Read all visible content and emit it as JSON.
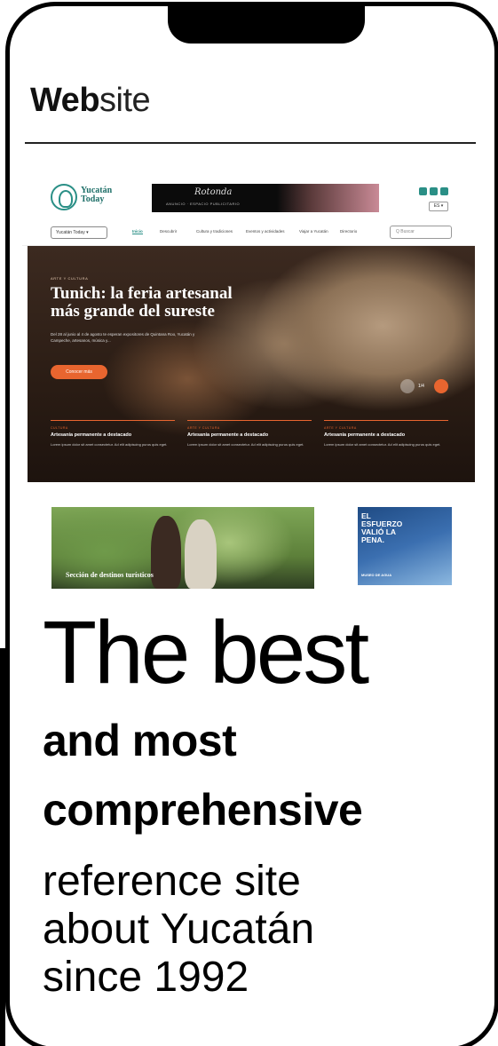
{
  "header": {
    "title_bold": "Web",
    "title_light": "site"
  },
  "site": {
    "logo_text_line1": "Yucatán",
    "logo_text_line2": "Today",
    "banner_script": "Rotonda",
    "banner_sub": "ANUNCIO · ESPACIO PUBLICITARIO",
    "lang": "ES ▾",
    "nav_select": "Yucatán Today ▾",
    "nav_items": [
      "Inicio",
      "Descubrir",
      "Cultura y tradiciones",
      "Eventos y actividades",
      "Viajar a Yucatán",
      "Directorio"
    ],
    "nav_search_placeholder": "Q  Buscar",
    "hero": {
      "tag": "ARTE Y CULTURA",
      "title": "Tunich: la feria artesanal más grande del sureste",
      "text": "Del 28 al junio al 4 de agosto te esperan expositores de Quintana Roo, Yucatán y Campeche, artesanos, música y...",
      "button": "Conocer más",
      "counter": "1/4"
    },
    "cards": [
      {
        "kicker": "CULTURA",
        "title": "Artesanía permanente a destacado",
        "text": "Lorem ipsum dolor sit amet consectetur. Ad elit adipiscing purus quis eget."
      },
      {
        "kicker": "ARTE Y CULTURA",
        "title": "Artesanía permanente a destacado",
        "text": "Lorem ipsum dolor sit amet consectetur. Ad elit adipiscing purus quis eget."
      },
      {
        "kicker": "ARTE Y CULTURA",
        "title": "Artesanía permanente a destacado",
        "text": "Lorem ipsum dolor sit amet consectetur. Ad elit adipiscing purus quis eget."
      }
    ],
    "promo_left_label": "Sección de destinos turísticos",
    "promo_right_text": "EL ESFUERZO VALIÓ LA PENA.",
    "promo_right_foot": "MUSEO DE AGUA"
  },
  "tagline": {
    "main": "The best",
    "sub1": "and most",
    "sub2": "comprehensive",
    "line1": "reference site",
    "line2": "about Yucatán",
    "line3": "since 1992"
  },
  "colors": {
    "accent": "#2a8f86",
    "cta": "#e8652f"
  }
}
